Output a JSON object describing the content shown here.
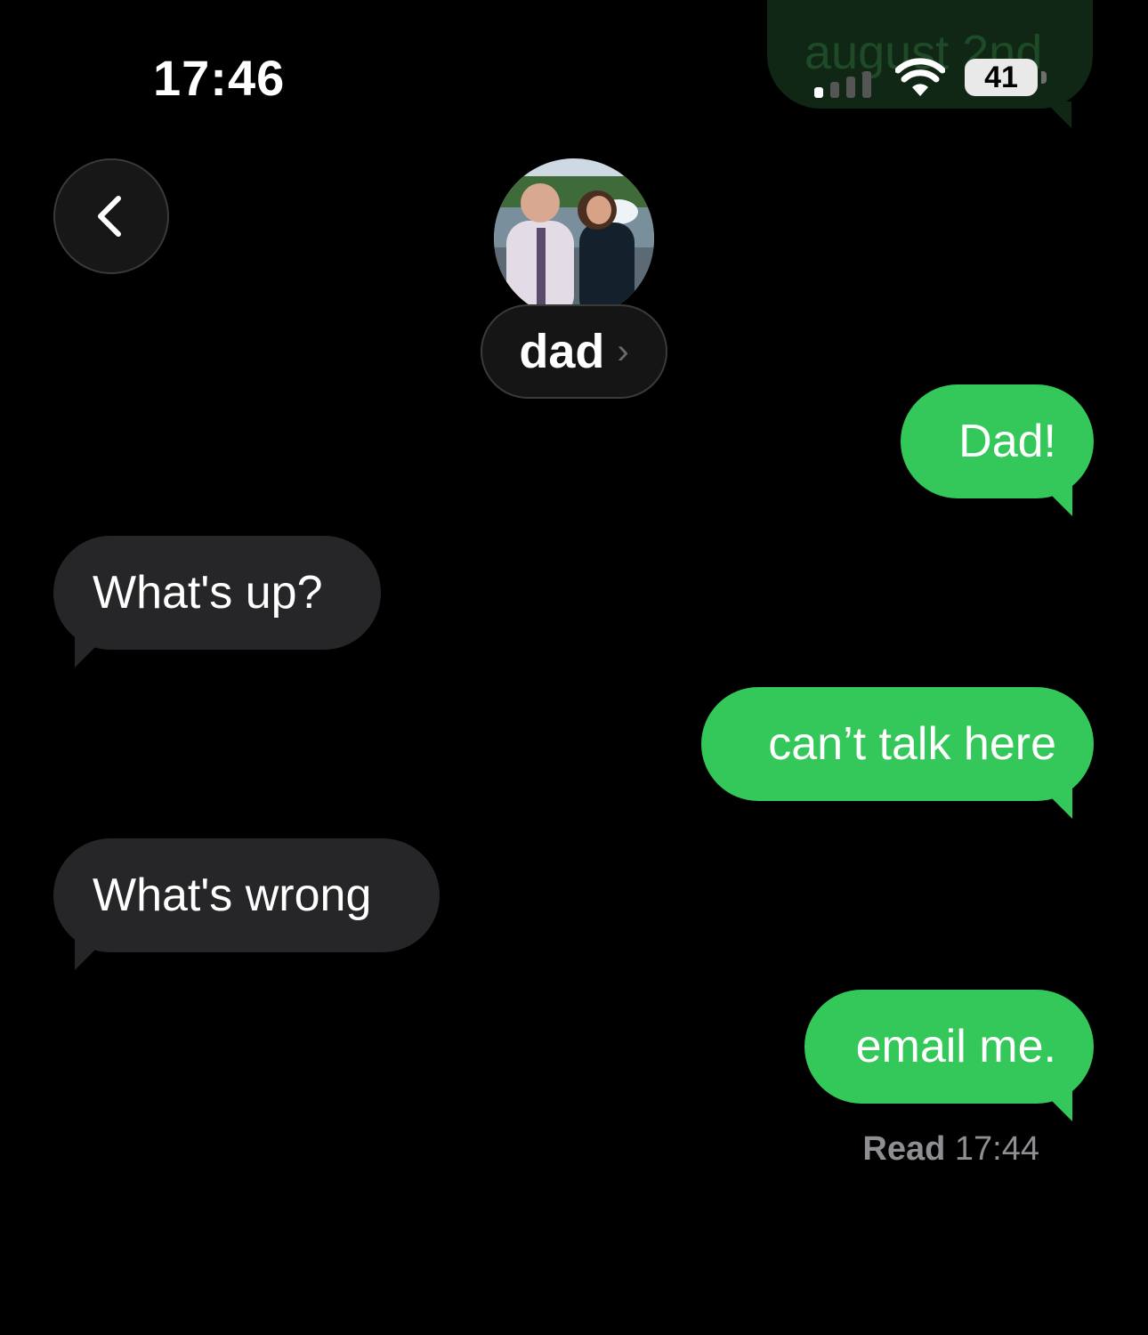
{
  "status_bar": {
    "time": "17:46",
    "battery": "41",
    "ghost_text": "august 2nd"
  },
  "header": {
    "contact_name": "dad",
    "chevron": "›"
  },
  "messages": [
    {
      "direction": "sent",
      "text": "Dad!"
    },
    {
      "direction": "received",
      "text": "What's up?"
    },
    {
      "direction": "sent",
      "text": "can’t talk here"
    },
    {
      "direction": "received",
      "text": "What's wrong"
    },
    {
      "direction": "sent",
      "text": "email me."
    }
  ],
  "receipt": {
    "label": "Read",
    "time": "17:44"
  },
  "colors": {
    "sent_bubble": "#34c759",
    "received_bubble": "#262628",
    "background": "#000000"
  },
  "icons": {
    "back": "chevron-left-icon",
    "signal": "cellular-signal-icon",
    "wifi": "wifi-icon",
    "battery": "battery-icon"
  }
}
